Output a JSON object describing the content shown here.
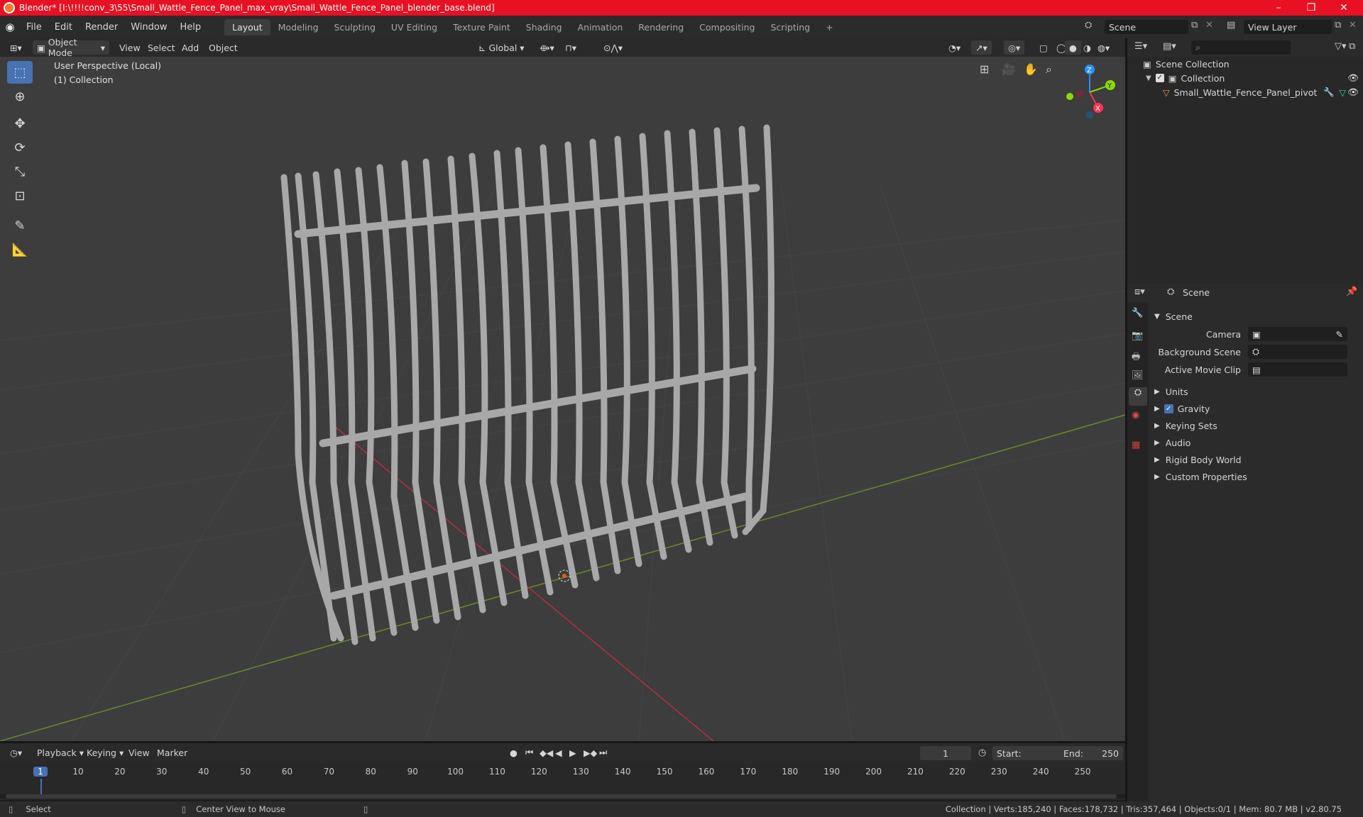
{
  "window": {
    "title": "Blender* [I:\\!!!!conv_3\\55\\Small_Wattle_Fence_Panel_max_vray\\Small_Wattle_Fence_Panel_blender_base.blend]",
    "minimize": "–",
    "maximize": "❐",
    "close": "✕"
  },
  "menu": [
    "File",
    "Edit",
    "Render",
    "Window",
    "Help"
  ],
  "workspaces": [
    "Layout",
    "Modeling",
    "Sculpting",
    "UV Editing",
    "Texture Paint",
    "Shading",
    "Animation",
    "Rendering",
    "Compositing",
    "Scripting"
  ],
  "workspace_add": "+",
  "scene_field": "Scene",
  "view_layer_field": "View Layer",
  "viewport_header": {
    "mode": "Object Mode",
    "menus": [
      "View",
      "Select",
      "Add",
      "Object"
    ],
    "orientation": "Global"
  },
  "viewport": {
    "perspective": "User Perspective (Local)",
    "collection": "(1) Collection",
    "gizmo": {
      "x": "X",
      "y": "Y",
      "z": "Z"
    }
  },
  "outliner": {
    "root": "Scene Collection",
    "collection": "Collection",
    "object": "Small_Wattle_Fence_Panel_pivot"
  },
  "properties": {
    "header": "Scene",
    "section": "Scene",
    "fields": [
      {
        "label": "Camera"
      },
      {
        "label": "Background Scene"
      },
      {
        "label": "Active Movie Clip"
      }
    ],
    "panels": [
      "Units",
      "Gravity",
      "Keying Sets",
      "Audio",
      "Rigid Body World",
      "Custom Properties"
    ],
    "gravity_checked": true
  },
  "timeline": {
    "menus": [
      "Playback",
      "Keying",
      "View",
      "Marker"
    ],
    "current_frame": "1",
    "start_label": "Start:",
    "start": "1",
    "end_label": "End:",
    "end": "250",
    "ruler": [
      "1",
      "10",
      "20",
      "30",
      "40",
      "50",
      "60",
      "70",
      "80",
      "90",
      "100",
      "110",
      "120",
      "130",
      "140",
      "150",
      "160",
      "170",
      "180",
      "190",
      "200",
      "210",
      "220",
      "230",
      "240",
      "250"
    ]
  },
  "status": {
    "left": "Select",
    "middle": "Center View to Mouse",
    "right": "Collection | Verts:185,240 | Faces:178,732 | Tris:357,464 | Objects:0/1 | Mem: 80.7 MB | v2.80.75"
  },
  "colors": {
    "accent": "#4772b3",
    "titlebar": "#e81123",
    "x_axis": "#ff3352",
    "y_axis": "#8bdc00",
    "z_axis": "#2890ff"
  }
}
